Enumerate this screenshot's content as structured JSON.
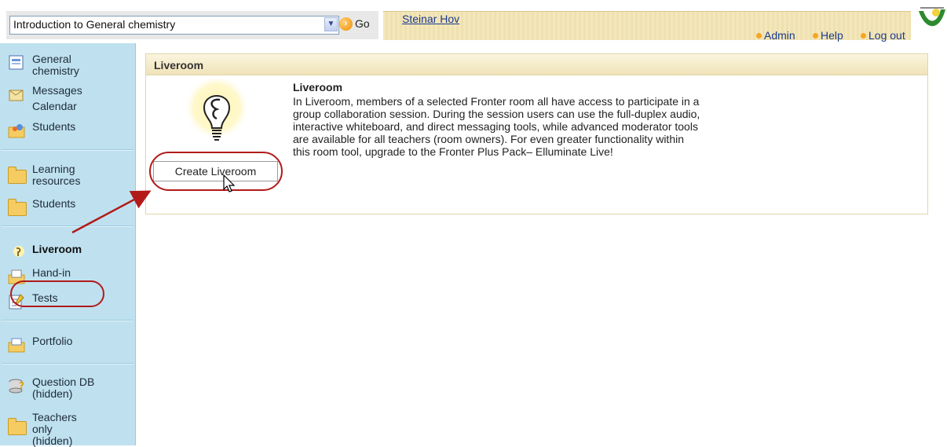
{
  "topbar": {
    "room_select_value": "Introduction to General chemistry",
    "go_label": "Go",
    "user_name": "Steinar Hov",
    "links": [
      "Admin",
      "Help",
      "Log out"
    ]
  },
  "sidebar": {
    "items": [
      {
        "label": "General chemistry",
        "icon": "general-chemistry-icon"
      },
      {
        "label": "Messages",
        "icon": "messages-icon"
      },
      {
        "label": "Calendar",
        "icon": "calendar-icon"
      },
      {
        "label": "Students",
        "icon": "students-icon"
      },
      {
        "label": "Learning resources",
        "icon": "folder-icon"
      },
      {
        "label": "Students",
        "icon": "folder-icon"
      },
      {
        "label": "Liveroom",
        "icon": "liveroom-icon"
      },
      {
        "label": "Hand-in",
        "icon": "hand-in-icon"
      },
      {
        "label": "Tests",
        "icon": "tests-icon"
      },
      {
        "label": "Portfolio",
        "icon": "portfolio-icon"
      },
      {
        "label": "Question DB (hidden)",
        "icon": "question-db-icon"
      },
      {
        "label": "Teachers only (hidden)",
        "icon": "folder-icon"
      }
    ]
  },
  "main": {
    "panel_title": "Liveroom",
    "description_title": "Liveroom",
    "description": "In Liveroom, members of a selected Fronter room all have access to participate in a group collaboration session. During the session users can use the full-duplex audio, interactive whiteboard, and direct messaging tools, while advanced moderator tools are available for all teachers (room owners). For even greater functionality within this room tool, upgrade to the Fronter Plus Pack– Elluminate Live!",
    "create_button_label": "Create Liveroom"
  },
  "colors": {
    "sidebar_bg": "#bfe1ef",
    "header_bg": "#f0e4b8",
    "highlight_red": "#b21a1a",
    "link_blue": "#1a3a8f"
  }
}
